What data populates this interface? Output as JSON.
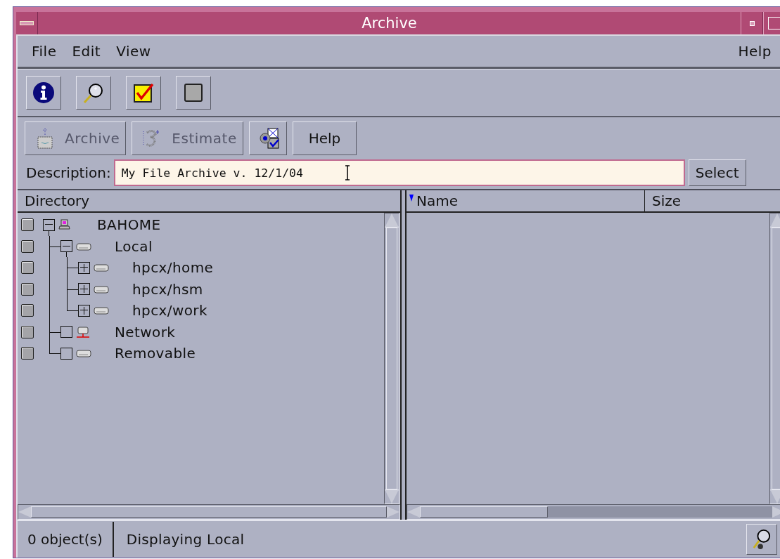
{
  "window": {
    "title": "Archive"
  },
  "menubar": {
    "items": [
      "File",
      "Edit",
      "View"
    ],
    "help": "Help"
  },
  "toolbar": [
    {
      "kind": "info"
    },
    {
      "kind": "search"
    },
    {
      "kind": "check-all"
    },
    {
      "kind": "clear"
    }
  ],
  "actions": [
    {
      "kind": "archive",
      "label": "Archive",
      "disabled": true
    },
    {
      "kind": "estimate",
      "label": "Estimate",
      "disabled": true
    },
    {
      "kind": "mail"
    },
    {
      "kind": "text",
      "label": "Help",
      "disabled": false
    }
  ],
  "description": {
    "label": "Description:",
    "value": "My File Archive v. 12/1/04",
    "button": "Select"
  },
  "directory": {
    "heading": "Directory",
    "tree": [
      {
        "label": "BAHOME",
        "kind": "computer",
        "checked": false,
        "expanded": true,
        "children": [
          {
            "label": "Local",
            "kind": "disk",
            "checked": false,
            "expanded": true,
            "children": [
              {
                "label": "hpcx/home",
                "kind": "disk",
                "checked": false,
                "expanded": false
              },
              {
                "label": "hpcx/hsm",
                "kind": "disk",
                "checked": false,
                "expanded": false
              },
              {
                "label": "hpcx/work",
                "kind": "disk",
                "checked": false,
                "expanded": false
              }
            ]
          },
          {
            "label": "Network",
            "kind": "network",
            "checked": false
          },
          {
            "label": "Removable",
            "kind": "disk",
            "checked": false
          }
        ]
      }
    ]
  },
  "files": {
    "columns": [
      {
        "label": "Name",
        "sorted": true
      },
      {
        "label": "Size",
        "sorted": false
      }
    ]
  },
  "status_bar": {
    "count": "0 object(s)",
    "message": "Displaying Local"
  }
}
